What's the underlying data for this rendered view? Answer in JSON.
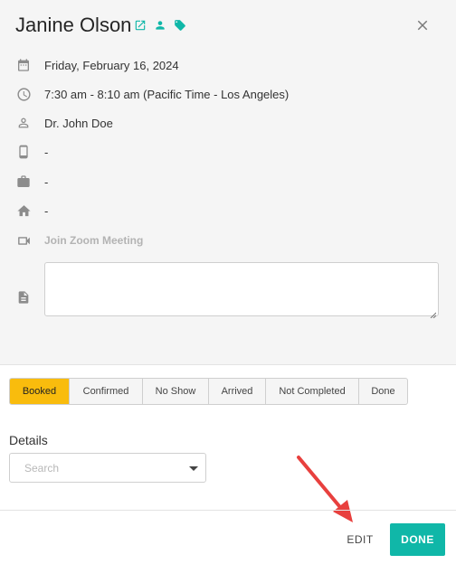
{
  "header": {
    "client_name": "Janine Olson",
    "icons": [
      "external-link-icon",
      "person-icon",
      "tag-icon"
    ],
    "close_icon": "close-icon"
  },
  "details": [
    {
      "icon": "calendar-icon",
      "text": "Friday, February 16, 2024"
    },
    {
      "icon": "clock-icon",
      "text": "7:30 am - 8:10 am (Pacific Time - Los Angeles)"
    },
    {
      "icon": "person-outline-icon",
      "text": "Dr. John Doe"
    },
    {
      "icon": "mobile-phone-icon",
      "text": "-"
    },
    {
      "icon": "briefcase-icon",
      "text": "-"
    },
    {
      "icon": "home-icon",
      "text": "-"
    },
    {
      "icon": "video-camera-icon",
      "text": "Join Zoom Meeting"
    }
  ],
  "notes": {
    "icon": "document-icon",
    "value": ""
  },
  "status": {
    "options": [
      "Booked",
      "Confirmed",
      "No Show",
      "Arrived",
      "Not Completed",
      "Done"
    ],
    "selected": "Booked"
  },
  "details_section": {
    "label": "Details",
    "placeholder": "Search"
  },
  "footer": {
    "edit_label": "EDIT",
    "done_label": "DONE"
  },
  "colors": {
    "accent": "#10b7a8",
    "status_active": "#f9bc0d",
    "annotation_arrow": "#e8403e"
  }
}
